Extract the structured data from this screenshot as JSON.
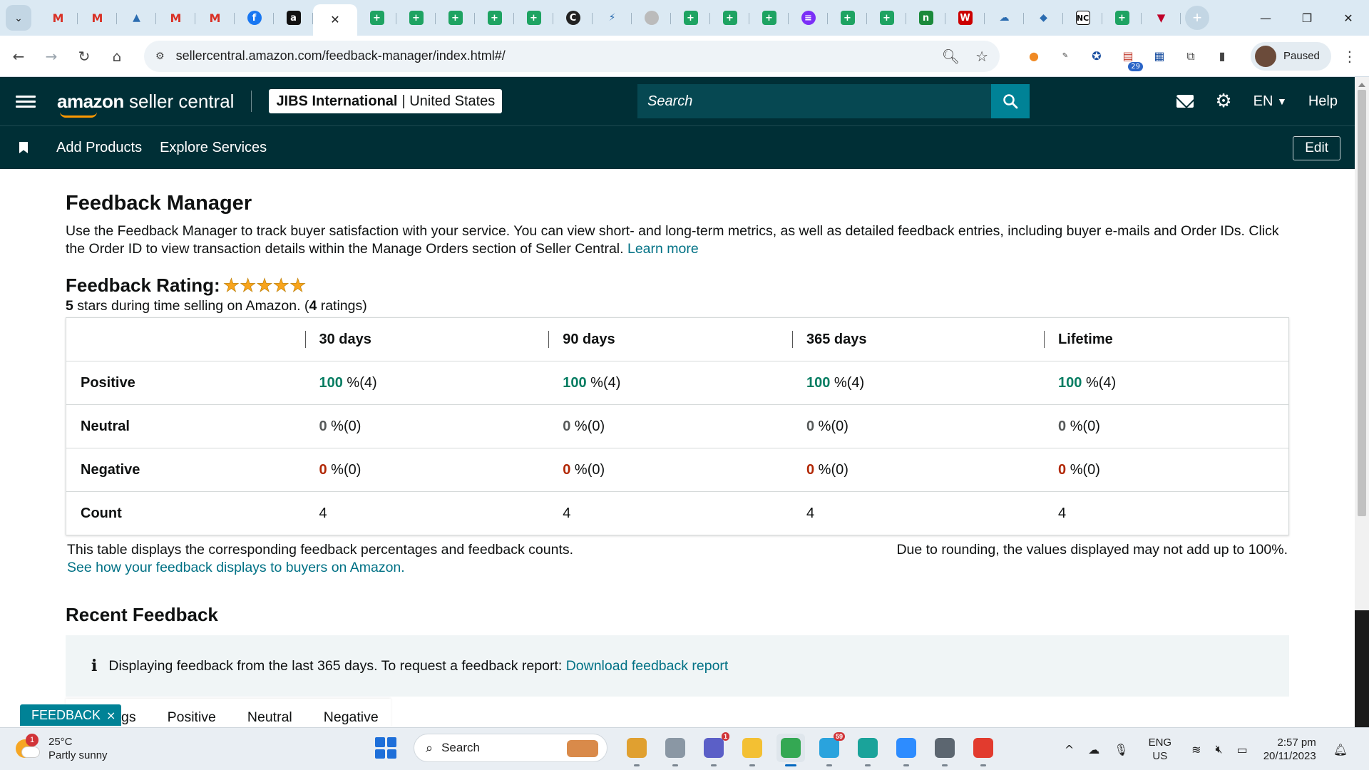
{
  "browser": {
    "tabs": [
      {
        "icon": "gmail-icon",
        "glyph": "M",
        "kind": "gmail"
      },
      {
        "icon": "gmail-icon",
        "glyph": "M",
        "kind": "gmail"
      },
      {
        "icon": "drive-icon",
        "glyph": "▲",
        "kind": "plain"
      },
      {
        "icon": "gmail-icon",
        "glyph": "M",
        "kind": "gmail"
      },
      {
        "icon": "gmail-icon",
        "glyph": "M",
        "kind": "gmail"
      },
      {
        "icon": "facebook-icon",
        "glyph": "f",
        "kind": "fb"
      },
      {
        "icon": "amazon-icon",
        "glyph": "a",
        "kind": "amz"
      },
      {
        "icon": "sheets-icon",
        "glyph": "+",
        "kind": "sheet"
      },
      {
        "icon": "sheets-icon",
        "glyph": "+",
        "kind": "sheet"
      },
      {
        "icon": "sheets-icon",
        "glyph": "+",
        "kind": "sheet"
      },
      {
        "icon": "sheets-icon",
        "glyph": "+",
        "kind": "sheet"
      },
      {
        "icon": "sheets-icon",
        "glyph": "+",
        "kind": "sheet"
      },
      {
        "icon": "circle-c-icon",
        "glyph": "C",
        "kind": "dark"
      },
      {
        "icon": "clickup-icon",
        "glyph": "⚡",
        "kind": "plain"
      },
      {
        "icon": "loading-icon",
        "glyph": "",
        "kind": "grey"
      },
      {
        "icon": "sheets-icon",
        "glyph": "+",
        "kind": "sheet"
      },
      {
        "icon": "sheets-icon",
        "glyph": "+",
        "kind": "sheet"
      },
      {
        "icon": "sheets-icon",
        "glyph": "+",
        "kind": "sheet"
      },
      {
        "icon": "purple-app-icon",
        "glyph": "≡",
        "kind": "purple"
      },
      {
        "icon": "sheets-icon",
        "glyph": "+",
        "kind": "sheet"
      },
      {
        "icon": "sheets-icon",
        "glyph": "+",
        "kind": "sheet"
      },
      {
        "icon": "green-n-icon",
        "glyph": "n",
        "kind": "green2"
      },
      {
        "icon": "red-w-icon",
        "glyph": "W",
        "kind": "red"
      },
      {
        "icon": "cloud-app-icon",
        "glyph": "☁",
        "kind": "plain"
      },
      {
        "icon": "blue-app-icon",
        "glyph": "◆",
        "kind": "plain"
      },
      {
        "icon": "nc-icon",
        "glyph": "NC",
        "kind": "nc"
      },
      {
        "icon": "sheets-icon",
        "glyph": "+",
        "kind": "sheet"
      },
      {
        "icon": "red-triangle-icon",
        "glyph": "▼",
        "kind": "tri"
      }
    ],
    "url": "sellercentral.amazon.com/feedback-manager/index.html#/",
    "profile_status": "Paused",
    "extension_badge": "29"
  },
  "header": {
    "brand_bold": "amazon",
    "brand_rest": " seller central",
    "account_name": "JIBS International",
    "account_sep": "|",
    "account_region": "United States",
    "search_placeholder": "Search",
    "language": "EN",
    "help": "Help"
  },
  "subnav": {
    "links": [
      "Add Products",
      "Explore Services"
    ],
    "edit": "Edit"
  },
  "page": {
    "title": "Feedback Manager",
    "intro": "Use the Feedback Manager to track buyer satisfaction with your service. You can view short- and long-term metrics, as well as detailed feedback entries, including buyer e-mails and Order IDs. Click the Order ID to view transaction details within the Manage Orders section of Seller Central.",
    "learn_more": "Learn more",
    "rating_label": "Feedback Rating:",
    "rating_stars": 5,
    "rating_sub_value": "5",
    "rating_sub_text": " stars during time selling on Amazon. (",
    "rating_sub_count": "4",
    "rating_sub_end": " ratings)"
  },
  "table": {
    "columns": [
      "30 days",
      "90 days",
      "365 days",
      "Lifetime"
    ],
    "rows": [
      {
        "label": "Positive",
        "kind": "pos",
        "cells": [
          {
            "pct": "100",
            "unit": " %(4)"
          },
          {
            "pct": "100",
            "unit": " %(4)"
          },
          {
            "pct": "100",
            "unit": " %(4)"
          },
          {
            "pct": "100",
            "unit": " %(4)"
          }
        ]
      },
      {
        "label": "Neutral",
        "kind": "neu",
        "cells": [
          {
            "pct": "0",
            "unit": " %(0)"
          },
          {
            "pct": "0",
            "unit": " %(0)"
          },
          {
            "pct": "0",
            "unit": " %(0)"
          },
          {
            "pct": "0",
            "unit": " %(0)"
          }
        ]
      },
      {
        "label": "Negative",
        "kind": "neg",
        "cells": [
          {
            "pct": "0",
            "unit": " %(0)"
          },
          {
            "pct": "0",
            "unit": " %(0)"
          },
          {
            "pct": "0",
            "unit": " %(0)"
          },
          {
            "pct": "0",
            "unit": " %(0)"
          }
        ]
      },
      {
        "label": "Count",
        "kind": "count",
        "cells": [
          {
            "pct": "",
            "unit": "4"
          },
          {
            "pct": "",
            "unit": "4"
          },
          {
            "pct": "",
            "unit": "4"
          },
          {
            "pct": "",
            "unit": "4"
          }
        ]
      }
    ],
    "note_left": "This table displays the corresponding feedback percentages and feedback counts.",
    "note_link": "See how your feedback displays to buyers on Amazon.",
    "note_right": "Due to rounding, the values displayed may not add up to 100%."
  },
  "recent": {
    "title": "Recent Feedback",
    "info": "Displaying feedback from the last 365 days. To request a feedback report:",
    "info_link": "Download feedback report",
    "filter_tabs": [
      "gs",
      "Positive",
      "Neutral",
      "Negative"
    ],
    "feedback_button": "FEEDBACK"
  },
  "taskbar": {
    "temp": "25°C",
    "weather": "Partly sunny",
    "weather_badge": "1",
    "search": "Search",
    "apps": [
      {
        "icon": "copilot-icon",
        "color": "#e0a030",
        "badge": ""
      },
      {
        "icon": "task-view-icon",
        "color": "#8a97a4",
        "badge": ""
      },
      {
        "icon": "teams-icon",
        "color": "#5b5fc7",
        "badge": "1"
      },
      {
        "icon": "file-explorer-icon",
        "color": "#f3c033",
        "badge": ""
      },
      {
        "icon": "chrome-icon",
        "color": "#34a853",
        "badge": "",
        "active": true
      },
      {
        "icon": "telegram-icon",
        "color": "#2aa3dd",
        "badge": "59"
      },
      {
        "icon": "edge-icon",
        "color": "#1aa39a",
        "badge": ""
      },
      {
        "icon": "zoom-icon",
        "color": "#2d8cff",
        "badge": ""
      },
      {
        "icon": "calculator-icon",
        "color": "#5c6670",
        "badge": ""
      },
      {
        "icon": "wps-icon",
        "color": "#e23b2e",
        "badge": ""
      }
    ],
    "lang_top": "ENG",
    "lang_bottom": "US",
    "time": "2:57 pm",
    "date": "20/11/2023"
  },
  "colors": {
    "header_bg": "#002f36",
    "link": "#007185",
    "positive": "#067d62",
    "negative": "#b12704",
    "star": "#f8a41c"
  }
}
